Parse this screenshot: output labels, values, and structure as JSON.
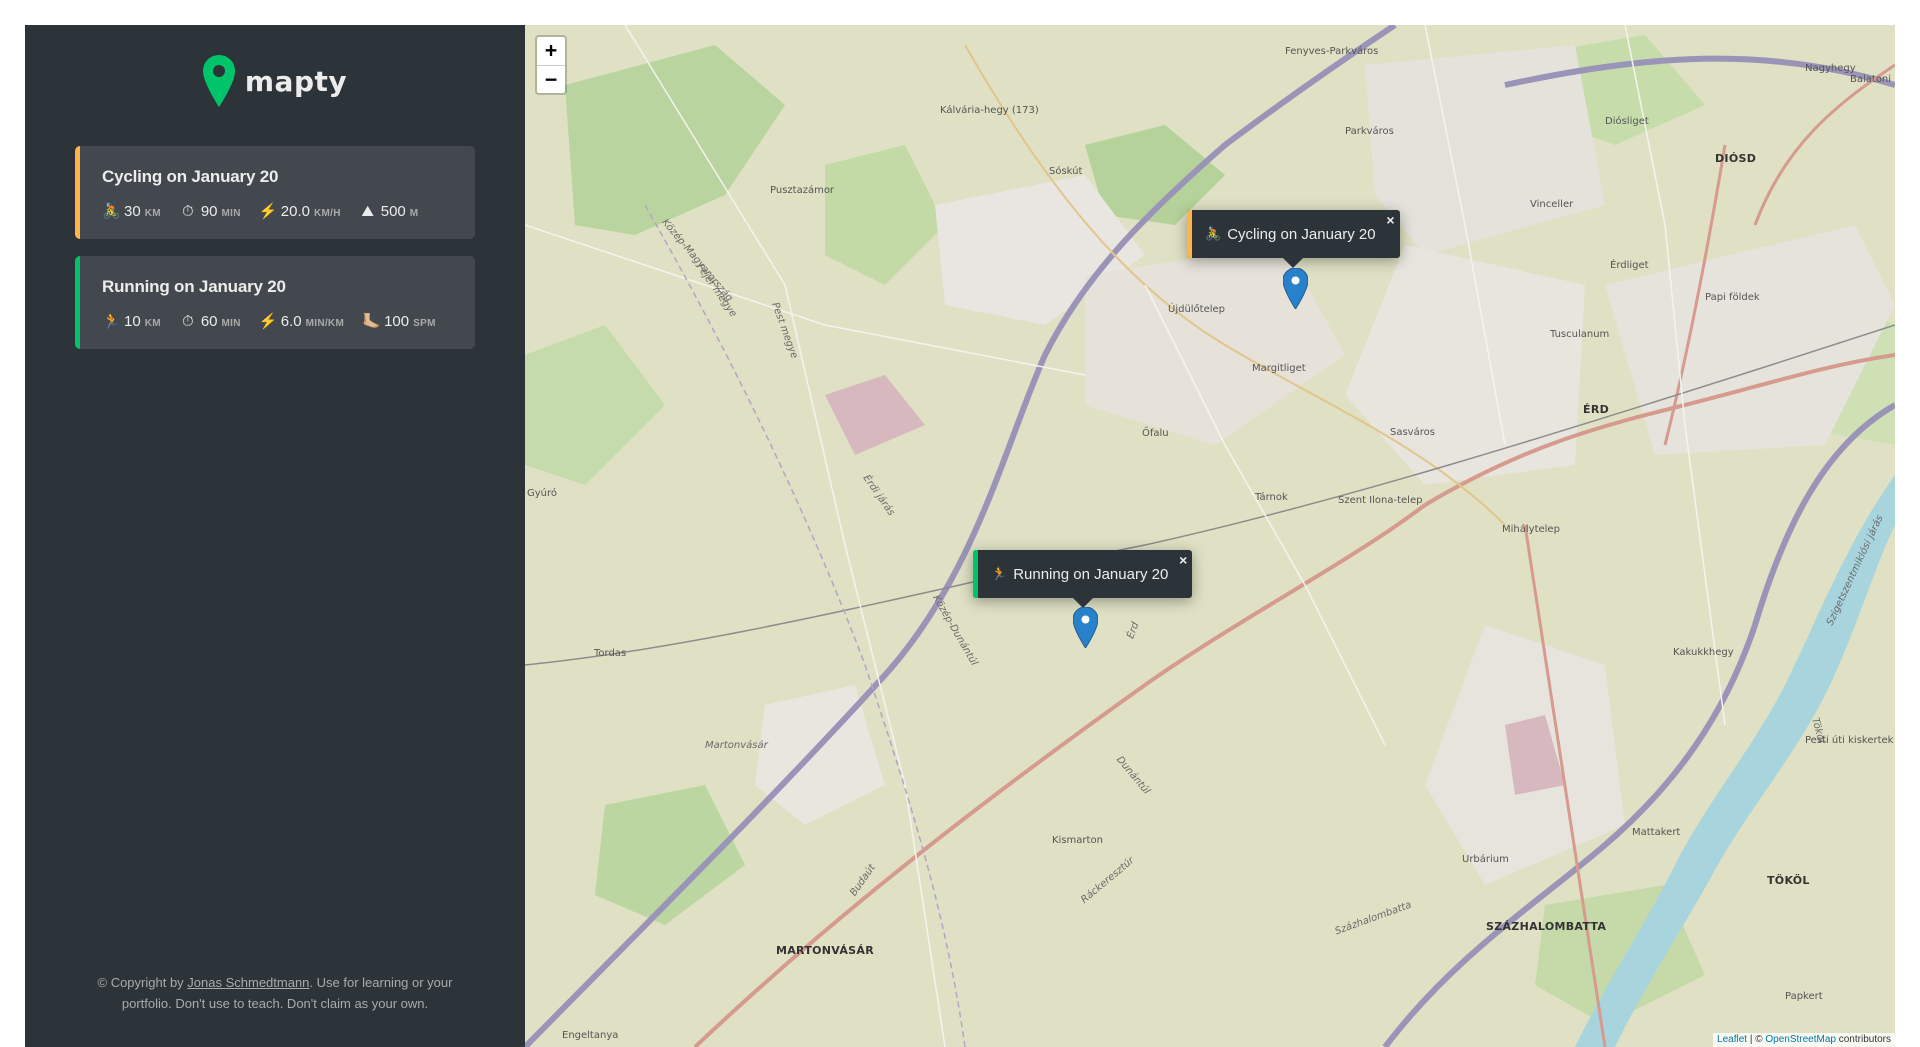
{
  "brand": {
    "name": "mapty",
    "accent": "#00c46a",
    "logo_icon": "map-pin-icon"
  },
  "colors": {
    "sidebar_bg": "#2d3439",
    "card_bg": "#42484d",
    "cycling_accent": "#ffb545",
    "running_accent": "#00c46a",
    "marker_blue": "#2a81cb"
  },
  "workouts": [
    {
      "type": "cycling",
      "title": "Cycling on January 20",
      "details": [
        {
          "icon": "🚴",
          "icon_name": "cyclist-icon",
          "value": "30",
          "unit": "km"
        },
        {
          "icon": "⏱",
          "icon_name": "stopwatch-icon",
          "value": "90",
          "unit": "min"
        },
        {
          "icon": "⚡️",
          "icon_name": "lightning-icon",
          "value": "20.0",
          "unit": "km/h"
        },
        {
          "icon": "⛰",
          "icon_name": "mountain-icon",
          "value": "500",
          "unit": "m"
        }
      ]
    },
    {
      "type": "running",
      "title": "Running on January 20",
      "details": [
        {
          "icon": "🏃",
          "icon_name": "runner-icon",
          "value": "10",
          "unit": "km"
        },
        {
          "icon": "⏱",
          "icon_name": "stopwatch-icon",
          "value": "60",
          "unit": "min"
        },
        {
          "icon": "⚡️",
          "icon_name": "lightning-icon",
          "value": "6.0",
          "unit": "min/km"
        },
        {
          "icon": "🦶🏼",
          "icon_name": "foot-icon",
          "value": "100",
          "unit": "spm"
        }
      ]
    }
  ],
  "copyright": {
    "prefix": "© Copyright by ",
    "author": "Jonas Schmedtmann",
    "suffix": ". Use for learning or your portfolio. Don't use to teach. Don't claim as your own."
  },
  "map": {
    "zoom_in": "+",
    "zoom_out": "−",
    "popups": [
      {
        "icon": "🚴",
        "text": "Cycling on January 20",
        "close": "×"
      },
      {
        "icon": "🏃",
        "text": "Running on January 20",
        "close": "×"
      }
    ],
    "labels": [
      "Kálvária-hegy (173)",
      "Sóskút",
      "Pusztazámor",
      "Parkváros",
      "Diósliget",
      "DIÓSD",
      "Vinceller",
      "Érdliget",
      "Papi földek",
      "Tusculanum",
      "Újdülőtelep",
      "Margitliget",
      "ÉRD",
      "Sasváros",
      "Tárnok",
      "Őfalu",
      "Szent Ilona-telep",
      "Mihálytelep",
      "Kakukkhegy",
      "Tordas",
      "Martonvásár",
      "MARTONVÁSÁR",
      "Kismarton",
      "Urbárium",
      "SZÁZHALOMBATTA",
      "Mattakert",
      "TÖKÖL",
      "Papkert",
      "Engeltanya",
      "Fenyves-Parkváros",
      "Nagyhegy",
      "Gyúró",
      "Balatoni",
      "Pest megye",
      "Fejér megye",
      "Közép-Magyarország",
      "Közép-Dunántúl",
      "Érdi járás",
      "Érd",
      "Dunántúl",
      "Ráckeresztúr",
      "Százhalombatta",
      "Budaút",
      "Tököl",
      "Szigetszentmiklósi járás",
      "Pesti úti kiskertek"
    ],
    "attribution": {
      "leaflet": "Leaflet",
      "sep": " | © ",
      "osm": "OpenStreetMap",
      "suffix": " contributors"
    }
  }
}
